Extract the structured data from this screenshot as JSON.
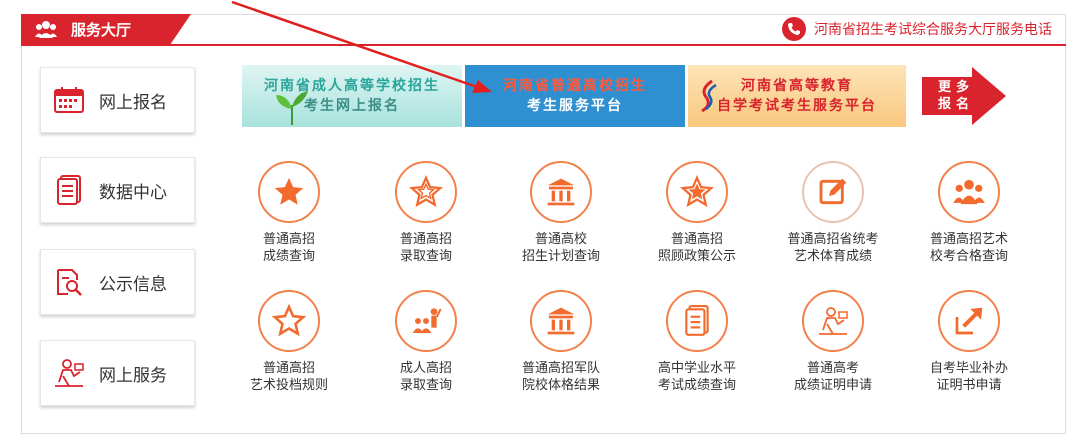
{
  "header": {
    "title": "服务大厅",
    "hotline": "河南省招生考试综合服务大厅服务电话"
  },
  "sidebar": {
    "items": [
      {
        "label": "网上报名",
        "icon": "calendar-icon"
      },
      {
        "label": "数据中心",
        "icon": "document-icon"
      },
      {
        "label": "公示信息",
        "icon": "notice-search-icon"
      },
      {
        "label": "网上服务",
        "icon": "service-person-icon"
      }
    ]
  },
  "banners": [
    {
      "line1": "河南省成人高等学校招生",
      "line2": "考生网上报名"
    },
    {
      "line1": "河南省普通高校招生",
      "line2": "考生服务平台"
    },
    {
      "line1": "河南省高等教育",
      "line2": "自学考试考生服务平台"
    }
  ],
  "more": {
    "l1": "更",
    "l2": "多",
    "l3": "报",
    "l4": "名"
  },
  "services": [
    {
      "line1": "普通高招",
      "line2": "成绩查询",
      "icon": "star-filled-icon"
    },
    {
      "line1": "普通高招",
      "line2": "录取查询",
      "icon": "star-outline-icon"
    },
    {
      "line1": "普通高校",
      "line2": "招生计划查询",
      "icon": "bank-building-icon"
    },
    {
      "line1": "普通高招",
      "line2": "照顾政策公示",
      "icon": "star-icon"
    },
    {
      "line1": "普通高招省统考",
      "line2": "艺术体育成绩",
      "icon": "edit-note-icon"
    },
    {
      "line1": "普通高招艺术",
      "line2": "校考合格查询",
      "icon": "group-icon"
    },
    {
      "line1": "普通高招",
      "line2": "艺术投档规则",
      "icon": "star-outline-icon"
    },
    {
      "line1": "成人高招",
      "line2": "录取查询",
      "icon": "teacher-icon"
    },
    {
      "line1": "普通高招军队",
      "line2": "院校体格结果",
      "icon": "bank-building-icon"
    },
    {
      "line1": "高中学业水平",
      "line2": "考试成绩查询",
      "icon": "document-icon"
    },
    {
      "line1": "普通高考",
      "line2": "成绩证明申请",
      "icon": "certificate-person-icon"
    },
    {
      "line1": "自考毕业补办",
      "line2": "证明书申请",
      "icon": "share-arrow-icon"
    }
  ],
  "colors": {
    "brand_red": "#d9232d",
    "accent_orange": "#f2814a",
    "banner_blue": "#2e8fd1"
  }
}
